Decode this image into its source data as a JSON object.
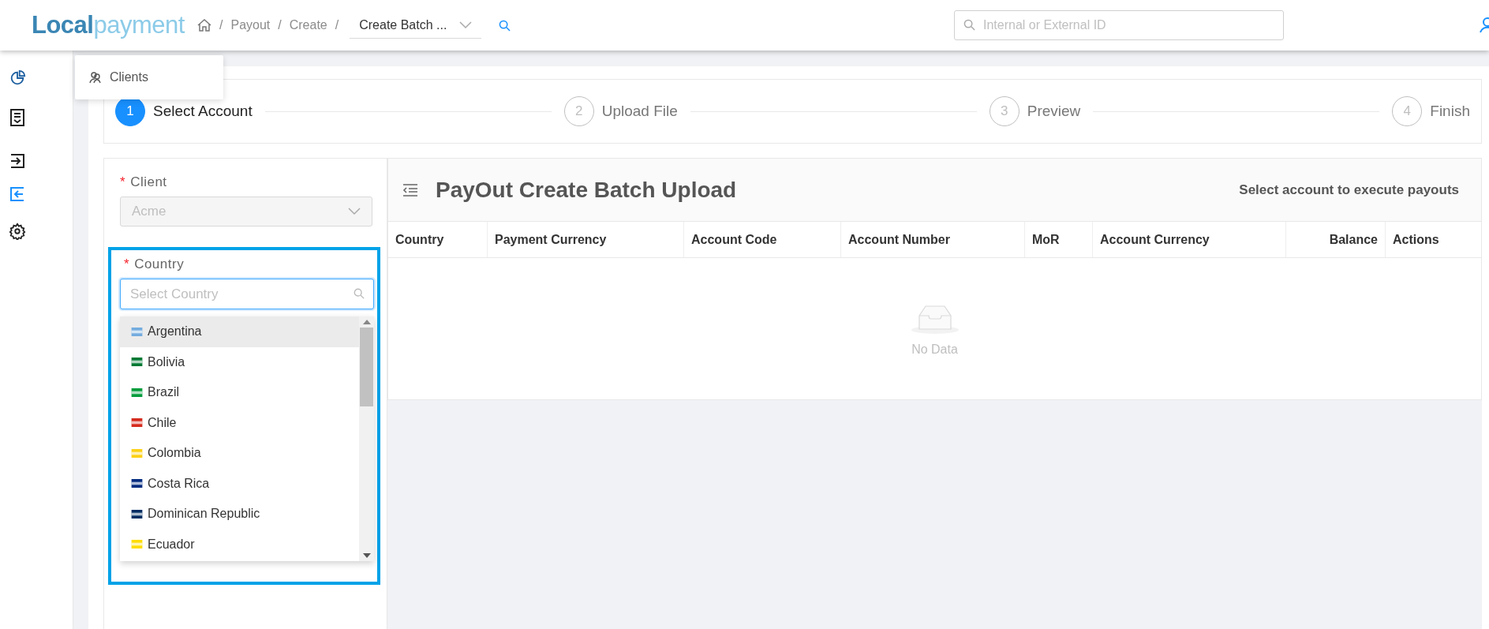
{
  "header": {
    "logo": {
      "text_1": "Local",
      "text_2": "payment"
    },
    "breadcrumbs": [
      {
        "kind": "home",
        "separator": "/"
      },
      {
        "kind": "link",
        "label": "Payout",
        "separator": "/"
      },
      {
        "kind": "link",
        "label": "Create",
        "separator": "/"
      }
    ],
    "page_select": {
      "value": "Create Batch ..."
    },
    "search": {
      "placeholder": "Internal or External ID"
    }
  },
  "sidebar": {
    "items": [
      {
        "kind": "chart",
        "selected": false
      },
      {
        "kind": "document",
        "selected": false
      },
      {
        "kind": "login",
        "selected": false
      },
      {
        "kind": "logout",
        "selected": true
      },
      {
        "kind": "settings",
        "selected": false
      }
    ]
  },
  "popup": {
    "label": "Clients"
  },
  "steps": [
    {
      "number": "1",
      "label": "Select Account",
      "selected": true
    },
    {
      "number": "2",
      "label": "Upload File",
      "selected": false
    },
    {
      "number": "3",
      "label": "Preview",
      "selected": false
    },
    {
      "number": "4",
      "label": "Finish",
      "selected": false
    }
  ],
  "form": {
    "client": {
      "required": "*",
      "label": "Client",
      "value": "Acme",
      "disabled": true
    },
    "country": {
      "required": "*",
      "label": "Country",
      "placeholder": "Select Country",
      "highlighted": true,
      "options": [
        {
          "label": "Argentina",
          "selected": true,
          "color": "#74acdf"
        },
        {
          "label": "Bolivia",
          "selected": false,
          "color": "#007934"
        },
        {
          "label": "Brazil",
          "selected": false,
          "color": "#009c3b"
        },
        {
          "label": "Chile",
          "selected": false,
          "color": "#d52b1e"
        },
        {
          "label": "Colombia",
          "selected": false,
          "color": "#fcd116"
        },
        {
          "label": "Costa Rica",
          "selected": false,
          "color": "#002b7f"
        },
        {
          "label": "Dominican Republic",
          "selected": false,
          "color": "#002d62"
        },
        {
          "label": "Ecuador",
          "selected": false,
          "color": "#ffdd00"
        }
      ]
    }
  },
  "table": {
    "title": "PayOut Create Batch Upload",
    "subtitle": "Select account to execute payouts",
    "columns": [
      {
        "label": "Country",
        "right_aligned": false
      },
      {
        "label": "Payment Currency",
        "right_aligned": false
      },
      {
        "label": "Account Code",
        "right_aligned": false
      },
      {
        "label": "Account Number",
        "right_aligned": false
      },
      {
        "label": "MoR",
        "right_aligned": false
      },
      {
        "label": "Account Currency",
        "right_aligned": false
      },
      {
        "label": "Balance",
        "right_aligned": true
      },
      {
        "label": "Actions",
        "right_aligned": false
      }
    ],
    "empty_text": "No Data"
  }
}
